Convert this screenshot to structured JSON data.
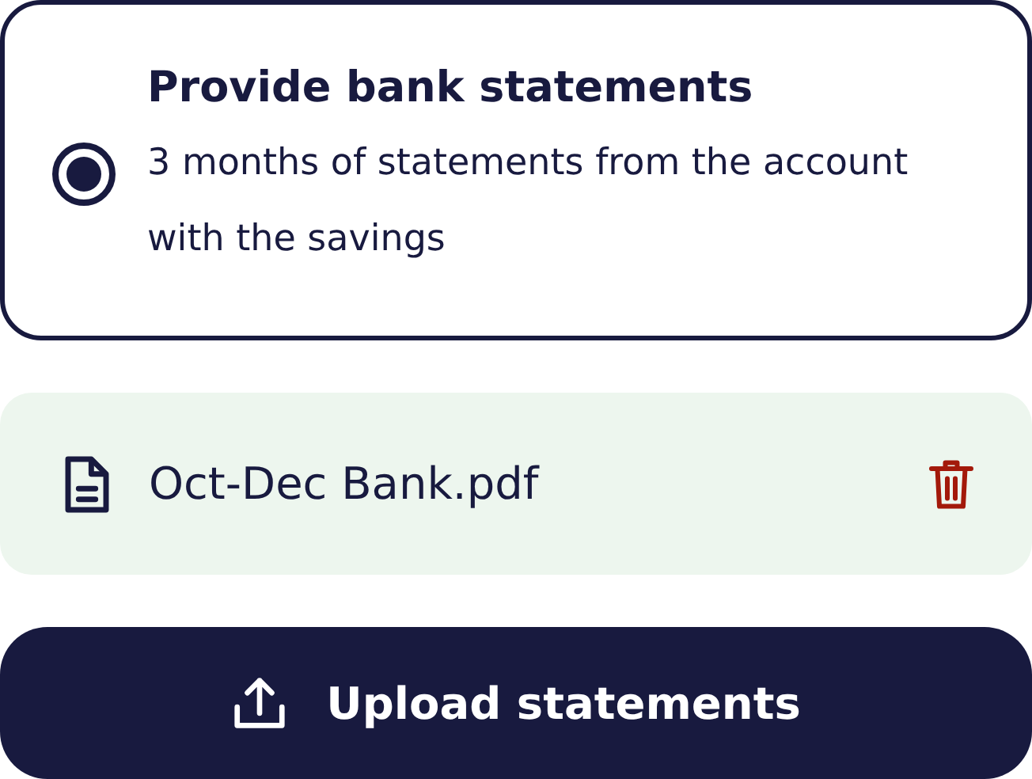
{
  "option": {
    "title": "Provide bank statements",
    "description": "3 months of statements from the account with the savings",
    "selected": true
  },
  "files": [
    {
      "name": "Oct-Dec Bank.pdf"
    }
  ],
  "upload_button": {
    "label": "Upload statements"
  }
}
